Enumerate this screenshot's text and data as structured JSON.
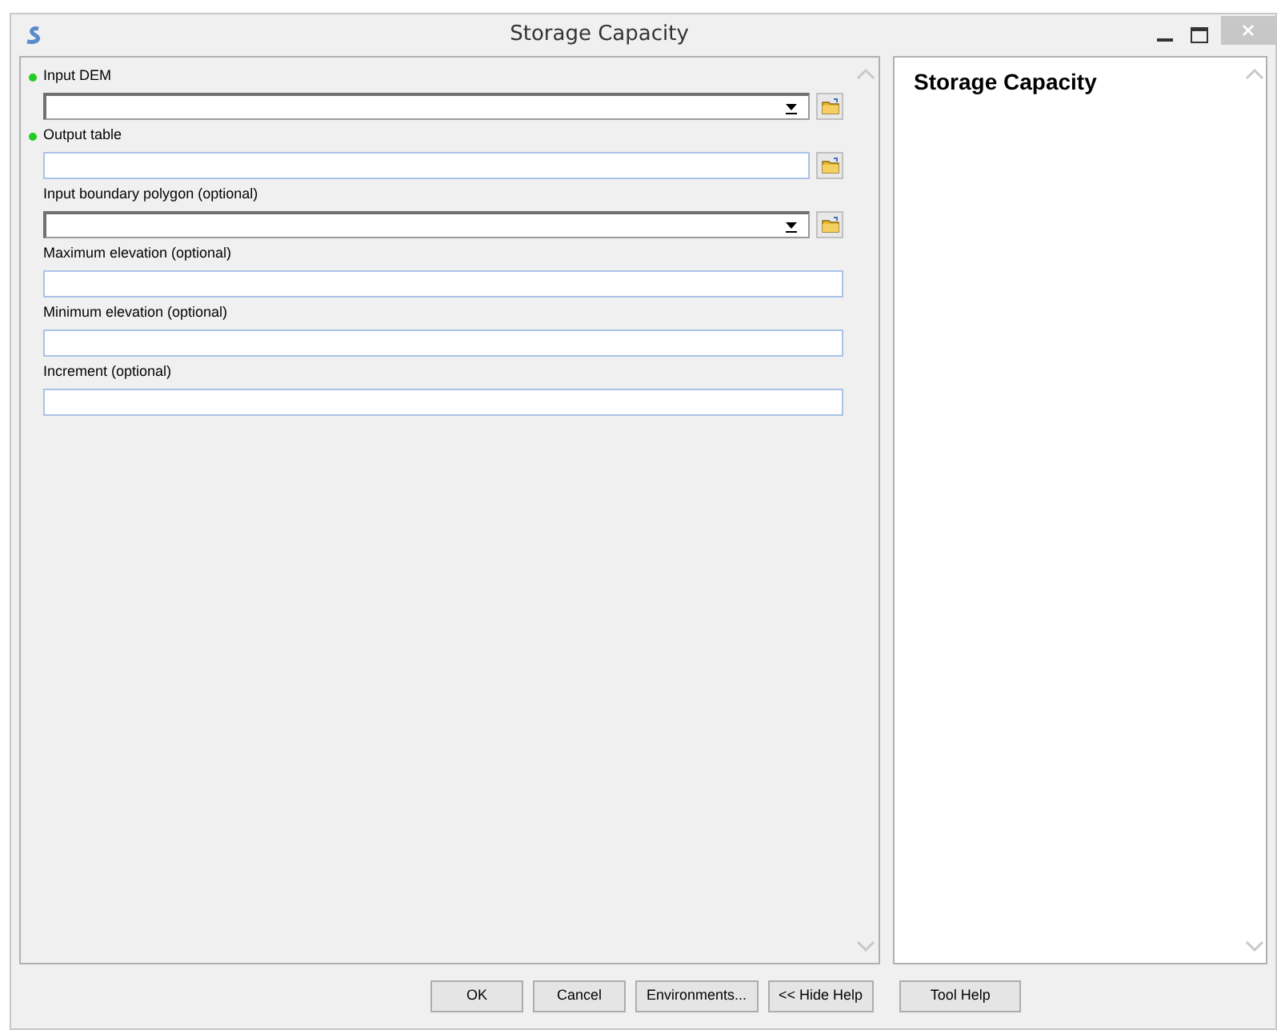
{
  "window": {
    "title": "Storage Capacity"
  },
  "parameters": [
    {
      "label": "Input DEM",
      "kind": "combo",
      "required": true
    },
    {
      "label": "Output table",
      "kind": "browse",
      "required": true
    },
    {
      "label": "Input boundary polygon (optional)",
      "kind": "combo",
      "required": false
    },
    {
      "label": "Maximum elevation (optional)",
      "kind": "text",
      "required": false
    },
    {
      "label": "Minimum elevation (optional)",
      "kind": "text",
      "required": false
    },
    {
      "label": "Increment (optional)",
      "kind": "text",
      "required": false
    }
  ],
  "help": {
    "title": "Storage Capacity"
  },
  "buttons": [
    "OK",
    "Cancel",
    "Environments...",
    "<< Hide Help"
  ],
  "help_button": "Tool Help"
}
